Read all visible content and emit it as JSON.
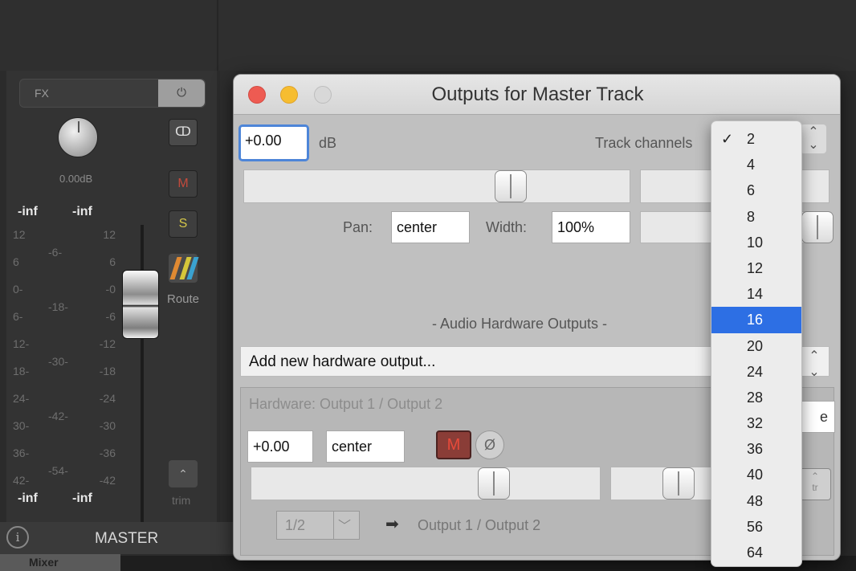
{
  "mixer": {
    "fx_label": "FX",
    "power_glyph": "⏻",
    "stereo_glyph": "ↀ",
    "db_value": "0.00dB",
    "peak_left": "-inf",
    "peak_right": "-inf",
    "mute_label": "M",
    "solo_label": "S",
    "route_label": "Route",
    "meter_left_scale": [
      "12",
      "6",
      "0-",
      "6-",
      "12-",
      "18-",
      "24-",
      "30-",
      "36-",
      "42-"
    ],
    "meter_mid_scale": [
      "-6-",
      "-18-",
      "-30-",
      "-42-",
      "-54-"
    ],
    "meter_right_scale": [
      "12",
      "6",
      "-0",
      "-6",
      "-12",
      "-18",
      "-24",
      "-30",
      "-36",
      "-42"
    ],
    "bottom_left": "-inf",
    "bottom_right": "-inf",
    "trim_label": "trim",
    "info_glyph": "i",
    "master_label": "MASTER",
    "mixer_tab_label": "Mixer"
  },
  "dialog": {
    "title": "Outputs for Master Track",
    "volume_value": "+0.00",
    "volume_unit": "dB",
    "track_channels_label": "Track channels",
    "pan_label": "Pan:",
    "pan_value": "center",
    "width_label": "Width:",
    "width_value": "100%",
    "hardware_section_label": "- Audio Hardware Outputs -",
    "add_hw_label": "Add new hardware output...",
    "hardware": {
      "title": "Hardware: Output 1 / Output 2",
      "volume_value": "+0.00",
      "pan_value": "center",
      "mute_label": "M",
      "phase_glyph": "Ø",
      "channel_value": "1/2",
      "arrow_glyph": "➡",
      "output_name": "Output 1 / Output 2",
      "right_field_value": "e",
      "tr_label": "tr"
    }
  },
  "channels_menu": {
    "checked": "2",
    "selected": "16",
    "check_glyph": "✓",
    "options": [
      "2",
      "4",
      "6",
      "8",
      "10",
      "12",
      "14",
      "16",
      "20",
      "24",
      "28",
      "32",
      "36",
      "40",
      "48",
      "56",
      "64"
    ]
  }
}
